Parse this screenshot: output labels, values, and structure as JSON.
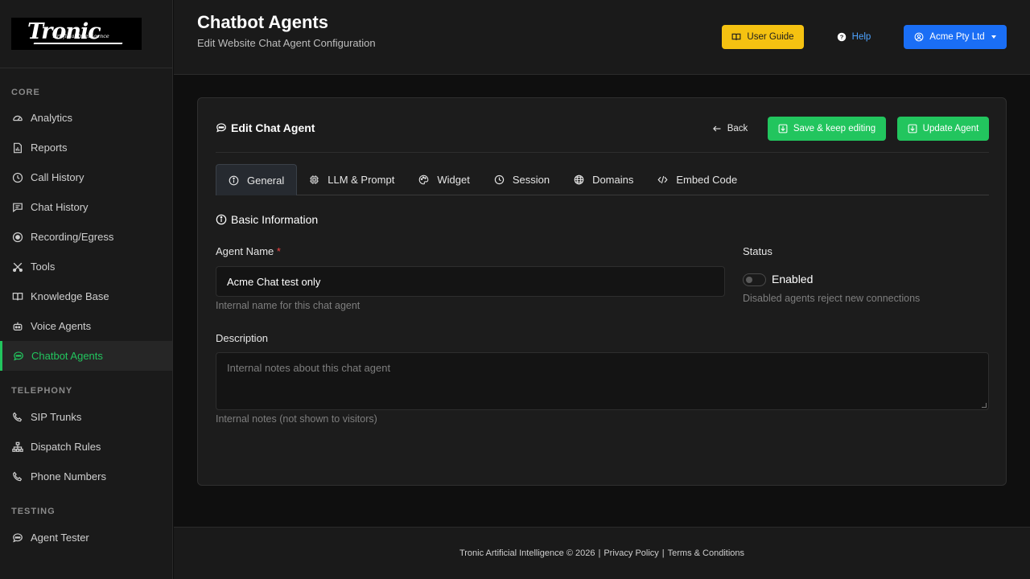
{
  "brand": {
    "logo_text": "Tronic",
    "logo_subtext": "Artificial Intelligence"
  },
  "sidebar": {
    "sections": [
      {
        "title": "CORE",
        "items": [
          {
            "label": "Analytics",
            "icon": "speedometer-icon"
          },
          {
            "label": "Reports",
            "icon": "report-icon"
          },
          {
            "label": "Call History",
            "icon": "clock-icon"
          },
          {
            "label": "Chat History",
            "icon": "chat-lines-icon"
          },
          {
            "label": "Recording/Egress",
            "icon": "record-icon"
          },
          {
            "label": "Tools",
            "icon": "tools-icon"
          },
          {
            "label": "Knowledge Base",
            "icon": "book-icon"
          },
          {
            "label": "Voice Agents",
            "icon": "robot-icon"
          },
          {
            "label": "Chatbot Agents",
            "icon": "chat-dots-icon",
            "active": true
          }
        ]
      },
      {
        "title": "TELEPHONY",
        "items": [
          {
            "label": "SIP Trunks",
            "icon": "phone-icon"
          },
          {
            "label": "Dispatch Rules",
            "icon": "diagram-icon"
          },
          {
            "label": "Phone Numbers",
            "icon": "phone-icon"
          }
        ]
      },
      {
        "title": "TESTING",
        "items": [
          {
            "label": "Agent Tester",
            "icon": "chat-dots-icon"
          }
        ]
      }
    ]
  },
  "header": {
    "title": "Chatbot Agents",
    "subtitle": "Edit Website Chat Agent Configuration",
    "user_guide_label": "User Guide",
    "help_label": "Help",
    "account_label": "Acme Pty Ltd"
  },
  "card": {
    "title": "Edit Chat Agent",
    "back_label": "Back",
    "save_keep_label": "Save & keep editing",
    "update_label": "Update Agent",
    "tabs": [
      {
        "label": "General",
        "icon": "info-icon",
        "active": true
      },
      {
        "label": "LLM & Prompt",
        "icon": "cpu-icon"
      },
      {
        "label": "Widget",
        "icon": "palette-icon"
      },
      {
        "label": "Session",
        "icon": "clock-icon"
      },
      {
        "label": "Domains",
        "icon": "globe-icon"
      },
      {
        "label": "Embed Code",
        "icon": "code-icon"
      }
    ],
    "section_title": "Basic Information",
    "agent_name": {
      "label": "Agent Name",
      "required_mark": "*",
      "value": "Acme Chat test only",
      "hint": "Internal name for this chat agent"
    },
    "status": {
      "label": "Status",
      "toggle_label": "Enabled",
      "enabled": false,
      "hint": "Disabled agents reject new connections"
    },
    "description": {
      "label": "Description",
      "placeholder": "Internal notes about this chat agent",
      "value": "",
      "hint": "Internal notes (not shown to visitors)"
    }
  },
  "footer": {
    "copyright": "Tronic Artificial Intelligence © 2026",
    "separator": "|",
    "privacy_label": "Privacy Policy",
    "terms_label": "Terms & Conditions"
  },
  "colors": {
    "accent_green": "#22c55e",
    "guide_yellow": "#f5c211",
    "account_blue": "#1a6ef5",
    "help_blue": "#4ea3ff",
    "required_red": "#ef4444"
  }
}
